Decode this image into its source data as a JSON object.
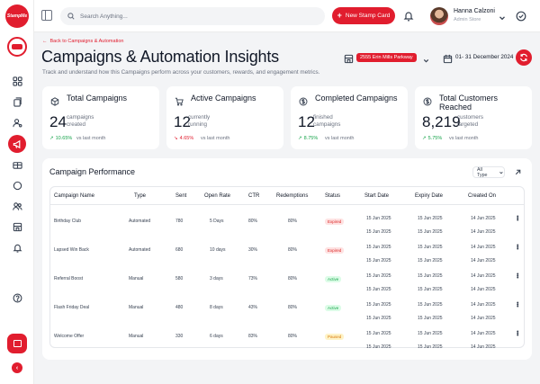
{
  "brand": {
    "logo_text": "StampMe",
    "accent": "#e11d2e"
  },
  "sidebar": {
    "icons": [
      "grid-icon",
      "stamps-icon",
      "user-settings-icon",
      "megaphone-icon",
      "gift-icon",
      "circle-icon",
      "users-icon",
      "store-icon",
      "bell-icon",
      "help-icon"
    ]
  },
  "header": {
    "search_placeholder": "Search Anything...",
    "new_button": "New Stamp Card",
    "user_name": "Hanna Calzoni",
    "user_role": "Admin Store"
  },
  "page": {
    "back_label": "Back to Campaigns & Automation",
    "title": "Campaigns & Automation Insights",
    "subtitle": "Track and understand how this Campaigns perform across your customers, rewards, and engagement metrics.",
    "store": "2555 Erin Mills Parkway",
    "date_range": "01- 31 December 2024"
  },
  "stats": [
    {
      "title": "Total Campaigns",
      "value": "24",
      "label1": "campaigns",
      "label2": "created",
      "trend": "10.65%",
      "direction": "up",
      "compare": "vs last month"
    },
    {
      "title": "Active Campaigns",
      "value": "12",
      "label1": "currently",
      "label2": "running",
      "trend": "4.65%",
      "direction": "down",
      "compare": "vs last month"
    },
    {
      "title": "Completed Campaigns",
      "value": "12",
      "label1": "finished",
      "label2": "campaigns",
      "trend": "8.75%",
      "direction": "up",
      "compare": "vs last month"
    },
    {
      "title": "Total Customers Reached",
      "value": "8,219",
      "label1": "customers",
      "label2": "targeted",
      "trend": "5.75%",
      "direction": "up",
      "compare": "vs last month"
    }
  ],
  "performance": {
    "title": "Campaign Performance",
    "filter": "All Type",
    "columns": [
      "Campaign Name",
      "Type",
      "Sent",
      "Open Rate",
      "CTR",
      "Redemptions",
      "Status",
      "Start Date",
      "Expiry Date",
      "Created On"
    ],
    "rows": [
      {
        "name": "Birthday Club",
        "type": "Automated",
        "sent": "780",
        "open_rate": "5 Days",
        "ctr": "80%",
        "redemptions": "80%",
        "status": "Expired",
        "status_kind": "expired",
        "start": "15 Jun 2025",
        "expiry": "15 Jun 2025",
        "created": "14 Jun 2025"
      },
      {
        "name": "",
        "type": "",
        "sent": "",
        "open_rate": "",
        "ctr": "",
        "redemptions": "",
        "status": "",
        "status_kind": "",
        "start": "15 Jun 2025",
        "expiry": "15 Jun 2025",
        "created": "14 Jun 2025"
      },
      {
        "name": "Lapsed Win Back",
        "type": "Automated",
        "sent": "680",
        "open_rate": "10 days",
        "ctr": "30%",
        "redemptions": "80%",
        "status": "Expired",
        "status_kind": "expired",
        "start": "15 Jun 2025",
        "expiry": "15 Jun 2025",
        "created": "14 Jun 2025"
      },
      {
        "name": "",
        "type": "",
        "sent": "",
        "open_rate": "",
        "ctr": "",
        "redemptions": "",
        "status": "",
        "status_kind": "",
        "start": "15 Jun 2025",
        "expiry": "15 Jun 2025",
        "created": "14 Jun 2025"
      },
      {
        "name": "Referral Boost",
        "type": "Manual",
        "sent": "580",
        "open_rate": "3 days",
        "ctr": "73%",
        "redemptions": "80%",
        "status": "Active",
        "status_kind": "active",
        "start": "15 Jun 2025",
        "expiry": "15 Jun 2025",
        "created": "14 Jun 2025"
      },
      {
        "name": "",
        "type": "",
        "sent": "",
        "open_rate": "",
        "ctr": "",
        "redemptions": "",
        "status": "",
        "status_kind": "",
        "start": "15 Jun 2025",
        "expiry": "15 Jun 2025",
        "created": "14 Jun 2025"
      },
      {
        "name": "Flash Friday Deal",
        "type": "Manual",
        "sent": "480",
        "open_rate": "8 days",
        "ctr": "43%",
        "redemptions": "80%",
        "status": "Active",
        "status_kind": "active",
        "start": "15 Jun 2025",
        "expiry": "15 Jun 2025",
        "created": "14 Jun 2025"
      },
      {
        "name": "",
        "type": "",
        "sent": "",
        "open_rate": "",
        "ctr": "",
        "redemptions": "",
        "status": "",
        "status_kind": "",
        "start": "15 Jun 2025",
        "expiry": "15 Jun 2025",
        "created": "14 Jun 2025"
      },
      {
        "name": "Welcome Offer",
        "type": "Manual",
        "sent": "330",
        "open_rate": "6 days",
        "ctr": "83%",
        "redemptions": "80%",
        "status": "Paused",
        "status_kind": "paused",
        "start": "15 Jun 2025",
        "expiry": "15 Jun 2025",
        "created": "14 Jun 2025"
      },
      {
        "name": "",
        "type": "",
        "sent": "",
        "open_rate": "",
        "ctr": "",
        "redemptions": "",
        "status": "",
        "status_kind": "",
        "start": "15 Jun 2025",
        "expiry": "15 Jun 2025",
        "created": "14 Jun 2025"
      }
    ]
  }
}
